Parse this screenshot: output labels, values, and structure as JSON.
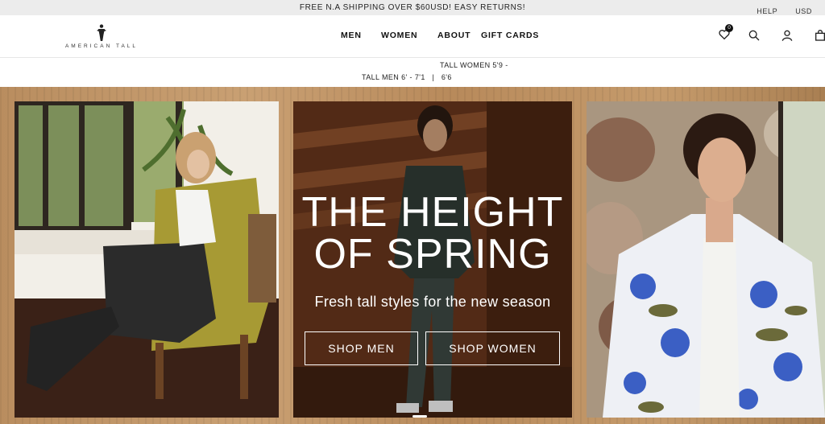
{
  "announcement": {
    "text": "FREE N.A SHIPPING OVER $60USD! EASY RETURNS!"
  },
  "utility": {
    "help": "HELP",
    "currency": "USD"
  },
  "brand": {
    "name": "AMERICAN TALL"
  },
  "nav": {
    "men": "MEN",
    "women": "WOMEN",
    "about": "ABOUT",
    "gift_cards": "GIFT CARDS"
  },
  "header_icons": {
    "wishlist": "heart-icon",
    "wishlist_count": "0",
    "search": "search-icon",
    "account": "user-icon",
    "cart": "bag-icon"
  },
  "subline": {
    "line1": "TALL WOMEN 5'9 -",
    "line2": "TALL MEN 6' - 7'1   |   6'6"
  },
  "hero": {
    "title_line1": "THE HEIGHT",
    "title_line2": "OF SPRING",
    "subtitle": "Fresh tall styles for the new season",
    "shop_men": "SHOP MEN",
    "shop_women": "SHOP WOMEN"
  },
  "colors": {
    "announcement_bg": "#ececec",
    "hero_frame": "#c9a073",
    "button_border": "#ffffff"
  }
}
